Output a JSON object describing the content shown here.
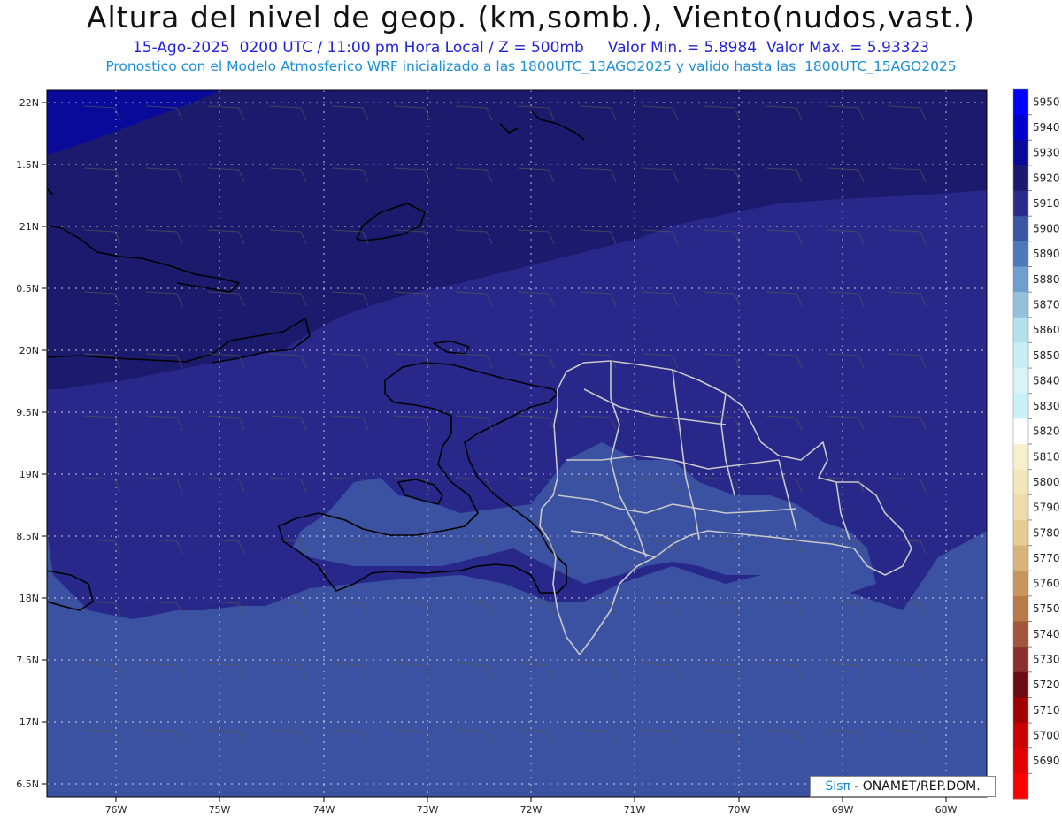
{
  "header": {
    "title": "Altura del nivel de geop. (km,somb.), Viento(nudos,vast.)",
    "line1": "15-Ago-2025  0200 UTC / 11:00 pm Hora Local / Z = 500mb     Valor Min. = 5.8984  Valor Max. = 5.93323",
    "line2": "Pronostico con el Modelo Atmosferico WRF inicializado a las 1800UTC_13AGO2025 y valido hasta las  1800UTC_15AGO2025"
  },
  "axes": {
    "lat_labels": [
      "22N",
      "1.5N",
      "21N",
      "0.5N",
      "20N",
      "9.5N",
      "19N",
      "8.5N",
      "18N",
      "7.5N",
      "17N",
      "6.5N"
    ],
    "lon_labels": [
      "76W",
      "75W",
      "74W",
      "73W",
      "72W",
      "71W",
      "70W",
      "69W",
      "68W"
    ]
  },
  "colorbar": {
    "levels": [
      5950,
      5940,
      5930,
      5920,
      5910,
      5900,
      5890,
      5880,
      5870,
      5860,
      5850,
      5840,
      5830,
      5820,
      5810,
      5800,
      5790,
      5780,
      5770,
      5760,
      5750,
      5740,
      5730,
      5720,
      5710,
      5700,
      5690
    ],
    "colors": [
      "#0000ff",
      "#0000cc",
      "#0a0a9a",
      "#191970",
      "#2a2a8c",
      "#3c55a5",
      "#4a7ab8",
      "#6f9fcf",
      "#95c0dd",
      "#b5e0ee",
      "#c9eef5",
      "#daf3f8",
      "#c8f2f6",
      "#ffffff",
      "#f8f0cc",
      "#f3e6bb",
      "#ecdcaa",
      "#e5cc95",
      "#d9b47a",
      "#c8955d",
      "#b87a48",
      "#a0563a",
      "#8a2e2e",
      "#6b0c14",
      "#a00000",
      "#c80000",
      "#e00000",
      "#ff0000"
    ]
  },
  "map_colors": {
    "dark": "#1b1a6d",
    "mid": "#27288a",
    "light": "#3a52a1",
    "darkest": "#0a0a9a"
  },
  "credit": {
    "logo": "Sisπ",
    "text": " - ONAMET/REP.DOM."
  }
}
